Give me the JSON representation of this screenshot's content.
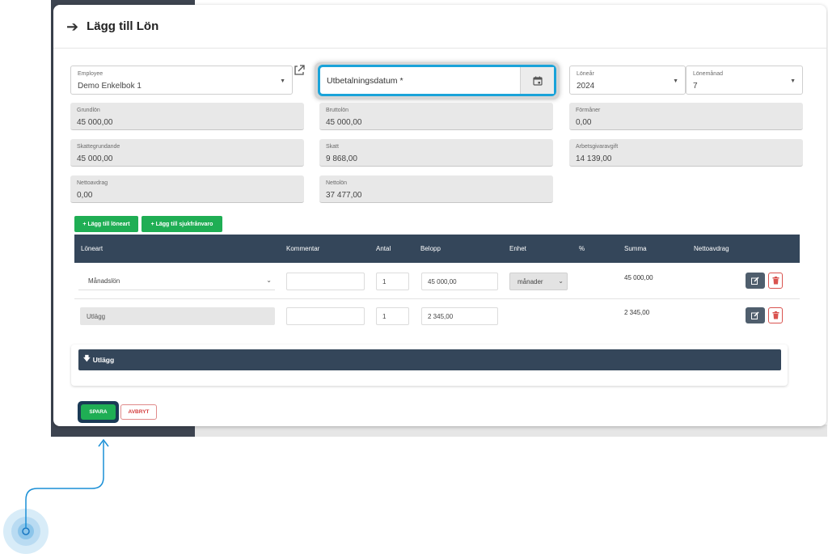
{
  "header": {
    "title": "Lägg till Lön"
  },
  "form": {
    "employee": {
      "label": "Employee",
      "value": "Demo Enkelbok 1"
    },
    "payment_date": {
      "placeholder": "Utbetalningsdatum *"
    },
    "year": {
      "label": "Löneår",
      "value": "2024"
    },
    "month": {
      "label": "Lönemånad",
      "value": "7"
    },
    "grundlon": {
      "label": "Grundlön",
      "value": "45 000,00"
    },
    "bruttolon": {
      "label": "Bruttolön",
      "value": "45 000,00"
    },
    "formaner": {
      "label": "Förmåner",
      "value": "0,00"
    },
    "skattegrundande": {
      "label": "Skattegrundande",
      "value": "45 000,00"
    },
    "skatt": {
      "label": "Skatt",
      "value": "9 868,00"
    },
    "arbetsgivaravgift": {
      "label": "Arbetsgivaravgift",
      "value": "14 139,00"
    },
    "nettoavdrag": {
      "label": "Nettoavdrag",
      "value": "0,00"
    },
    "nettolon": {
      "label": "Nettolön",
      "value": "37 477,00"
    }
  },
  "actions": {
    "add_wage_type": "+ Lägg till löneart",
    "add_sick_leave": "+ Lägg till sjukfrånvaro"
  },
  "table": {
    "headers": [
      "Löneart",
      "Kommentar",
      "Antal",
      "Belopp",
      "Enhet",
      "%",
      "Summa",
      "Nettoavdrag"
    ],
    "rows": [
      {
        "type": "Månadslön",
        "comment": "",
        "quantity": "1",
        "amount": "45 000,00",
        "unit": "månader",
        "sum": "45 000,00"
      },
      {
        "type": "Utlägg",
        "comment": "",
        "quantity": "1",
        "amount": "2 345,00",
        "unit": "",
        "sum": "2 345,00"
      }
    ]
  },
  "expenses": {
    "title": "Utlägg"
  },
  "footer": {
    "save": "SPARA",
    "cancel": "AVBRYT"
  },
  "colors": {
    "accent": "#1aa3d9",
    "green": "#1fae54",
    "table_header": "#34465a",
    "danger": "#d9534f"
  }
}
